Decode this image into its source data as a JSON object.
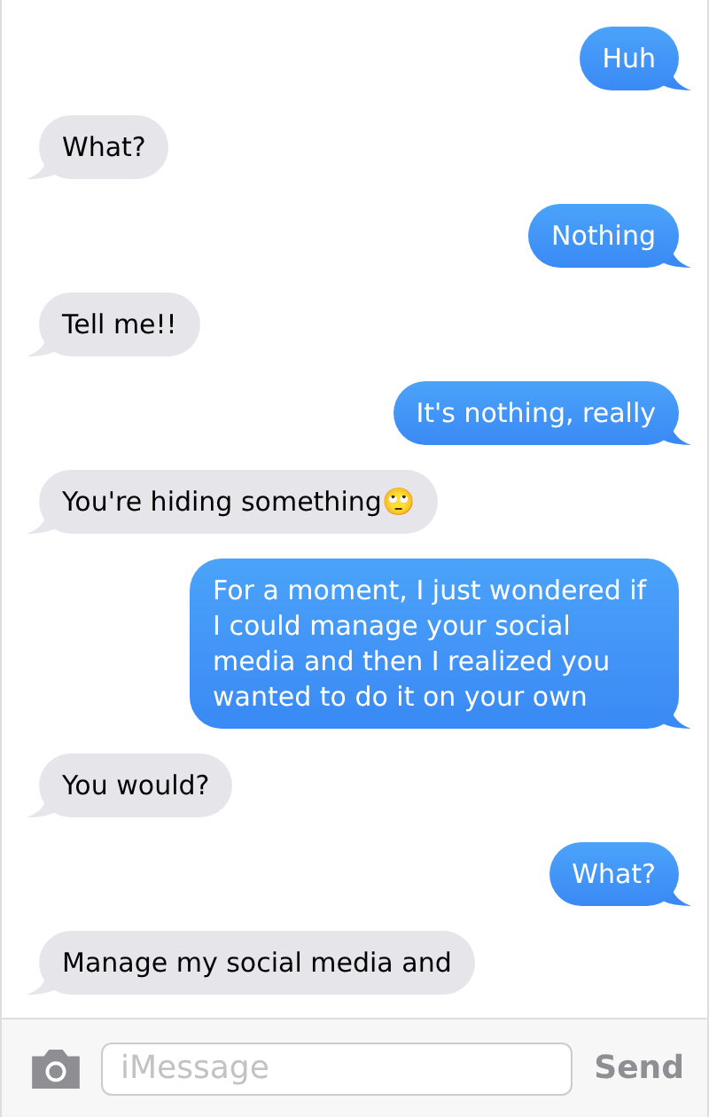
{
  "messages": [
    {
      "kind": "sent",
      "text": "Huh"
    },
    {
      "kind": "received",
      "text": "What?"
    },
    {
      "kind": "sent",
      "text": "Nothing"
    },
    {
      "kind": "received",
      "text": "Tell me!!"
    },
    {
      "kind": "sent",
      "text": "It's nothing, really"
    },
    {
      "kind": "received",
      "text": "You're hiding something🙄"
    },
    {
      "kind": "sent",
      "text": "For a moment, I just wondered if I could manage your social media and then I realized you wanted to do it on your own"
    },
    {
      "kind": "received",
      "text": "You would?"
    },
    {
      "kind": "sent",
      "text": "What?"
    },
    {
      "kind": "received",
      "text": "Manage my social media and"
    }
  ],
  "composer": {
    "placeholder": "iMessage",
    "send": "Send"
  }
}
